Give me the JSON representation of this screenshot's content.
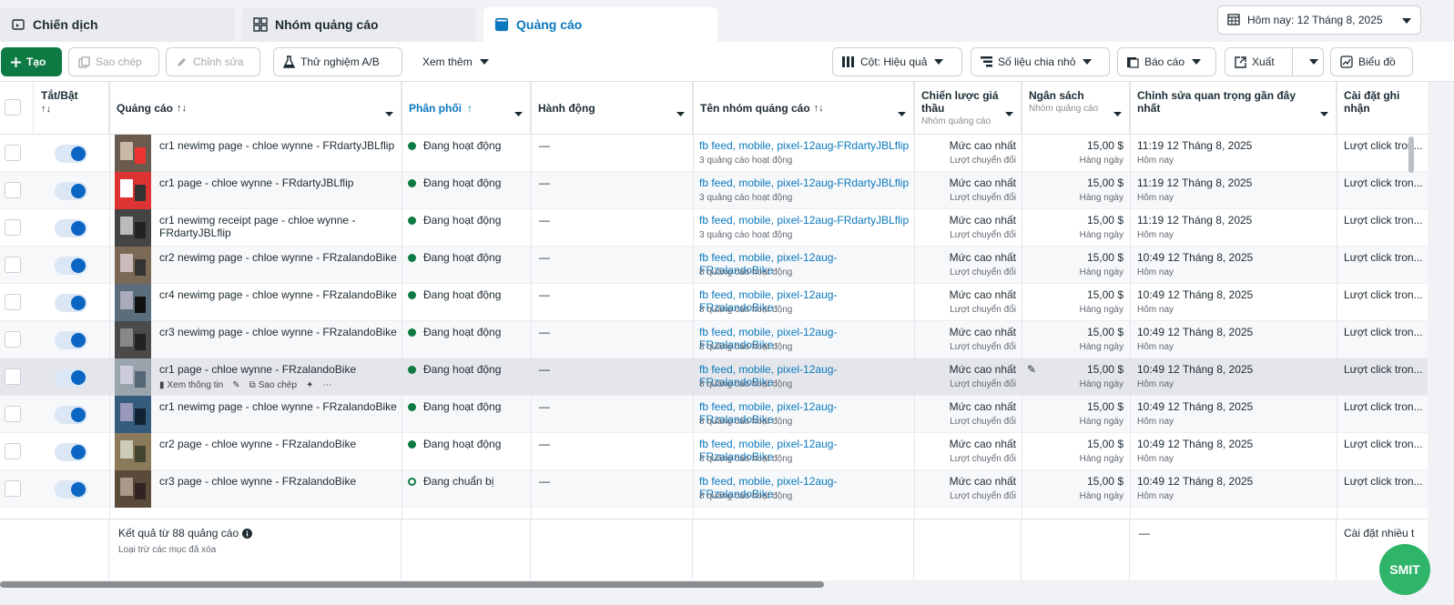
{
  "tabs": [
    {
      "label": "Chiến dịch",
      "icon": "folder-icon",
      "active": false
    },
    {
      "label": "Nhóm quảng cáo",
      "icon": "grid-icon",
      "active": false
    },
    {
      "label": "Quảng cáo",
      "icon": "ad-icon",
      "active": true
    }
  ],
  "date_range": {
    "label": "Hôm nay: 12 Tháng 8, 2025"
  },
  "toolbar": {
    "create": "Tạo",
    "duplicate": "Sao chép",
    "edit": "Chỉnh sửa",
    "ab_test": "Thử nghiệm A/B",
    "more": "Xem thêm",
    "columns": "Cột: Hiệu quả",
    "breakdown": "Số liệu chia nhỏ",
    "reports": "Báo cáo",
    "export": "Xuất",
    "charts": "Biểu đồ"
  },
  "columns": {
    "toggle": "Tắt/Bật",
    "ad": "Quảng cáo",
    "delivery": "Phân phối",
    "actions": "Hành động",
    "adset": "Tên nhóm quảng cáo",
    "bid_strategy": "Chiến lược giá thầu",
    "bid_strategy_sub": "Nhóm quảng cáo",
    "budget": "Ngân sách",
    "budget_sub": "Nhóm quảng cáo",
    "last_edit": "Chỉnh sửa quan trọng gần đây nhất",
    "attribution": "Cài đặt ghi nhận"
  },
  "rows": [
    {
      "name": "cr1 newimg page - chloe wynne - FRdartyJBLflip",
      "status": "Đang hoạt động",
      "action": "—",
      "adset": "fb feed, mobile, pixel-12aug-FRdartyJBLflip",
      "adset_sub": "3 quảng cáo hoạt động",
      "bid": "Mức cao nhất",
      "bid_sub": "Lượt chuyển đổi",
      "budget": "15,00 $",
      "budget_sub": "Hàng ngày",
      "edited": "11:19 12 Tháng 8, 2025",
      "edited_sub": "Hôm nay",
      "attribution": "Lượt click tron..."
    },
    {
      "name": "cr1 page - chloe wynne - FRdartyJBLflip",
      "status": "Đang hoạt động",
      "action": "—",
      "adset": "fb feed, mobile, pixel-12aug-FRdartyJBLflip",
      "adset_sub": "3 quảng cáo hoạt động",
      "bid": "Mức cao nhất",
      "bid_sub": "Lượt chuyển đổi",
      "budget": "15,00 $",
      "budget_sub": "Hàng ngày",
      "edited": "11:19 12 Tháng 8, 2025",
      "edited_sub": "Hôm nay",
      "attribution": "Lượt click tron..."
    },
    {
      "name": "cr1 newimg receipt page - chloe wynne - FRdartyJBLflip",
      "status": "Đang hoạt động",
      "action": "—",
      "adset": "fb feed, mobile, pixel-12aug-FRdartyJBLflip",
      "adset_sub": "3 quảng cáo hoạt động",
      "bid": "Mức cao nhất",
      "bid_sub": "Lượt chuyển đổi",
      "budget": "15,00 $",
      "budget_sub": "Hàng ngày",
      "edited": "11:19 12 Tháng 8, 2025",
      "edited_sub": "Hôm nay",
      "attribution": "Lượt click tron..."
    },
    {
      "name": "cr2 newimg page - chloe wynne - FRzalandoBike",
      "status": "Đang hoạt động",
      "action": "—",
      "adset": "fb feed, mobile, pixel-12aug-FRzalandoBike",
      "adset_sub": "8 quảng cáo hoạt động",
      "bid": "Mức cao nhất",
      "bid_sub": "Lượt chuyển đổi",
      "budget": "15,00 $",
      "budget_sub": "Hàng ngày",
      "edited": "10:49 12 Tháng 8, 2025",
      "edited_sub": "Hôm nay",
      "attribution": "Lượt click tron..."
    },
    {
      "name": "cr4 newimg page - chloe wynne - FRzalandoBike",
      "status": "Đang hoạt động",
      "action": "—",
      "adset": "fb feed, mobile, pixel-12aug-FRzalandoBike",
      "adset_sub": "8 quảng cáo hoạt động",
      "bid": "Mức cao nhất",
      "bid_sub": "Lượt chuyển đổi",
      "budget": "15,00 $",
      "budget_sub": "Hàng ngày",
      "edited": "10:49 12 Tháng 8, 2025",
      "edited_sub": "Hôm nay",
      "attribution": "Lượt click tron..."
    },
    {
      "name": "cr3 newimg page - chloe wynne - FRzalandoBike",
      "status": "Đang hoạt động",
      "action": "—",
      "adset": "fb feed, mobile, pixel-12aug-FRzalandoBike",
      "adset_sub": "8 quảng cáo hoạt động",
      "bid": "Mức cao nhất",
      "bid_sub": "Lượt chuyển đổi",
      "budget": "15,00 $",
      "budget_sub": "Hàng ngày",
      "edited": "10:49 12 Tháng 8, 2025",
      "edited_sub": "Hôm nay",
      "attribution": "Lượt click tron..."
    },
    {
      "name": "cr1 page - chloe wynne - FRzalandoBike",
      "status": "Đang hoạt động",
      "action": "—",
      "adset": "fb feed, mobile, pixel-12aug-FRzalandoBike",
      "adset_sub": "8 quảng cáo hoạt động",
      "bid": "Mức cao nhất",
      "bid_sub": "Lượt chuyển đổi",
      "budget": "15,00 $",
      "budget_sub": "Hàng ngày",
      "edited": "10:49 12 Tháng 8, 2025",
      "edited_sub": "Hôm nay",
      "attribution": "Lượt click tron...",
      "hover": true,
      "hover_view": "Xem thông tin",
      "hover_copy": "Sao chép"
    },
    {
      "name": "cr1 newimg page - chloe wynne - FRzalandoBike",
      "status": "Đang hoạt động",
      "action": "—",
      "adset": "fb feed, mobile, pixel-12aug-FRzalandoBike",
      "adset_sub": "8 quảng cáo hoạt động",
      "bid": "Mức cao nhất",
      "bid_sub": "Lượt chuyển đổi",
      "budget": "15,00 $",
      "budget_sub": "Hàng ngày",
      "edited": "10:49 12 Tháng 8, 2025",
      "edited_sub": "Hôm nay",
      "attribution": "Lượt click tron..."
    },
    {
      "name": "cr2 page - chloe wynne - FRzalandoBike",
      "status": "Đang hoạt động",
      "action": "—",
      "adset": "fb feed, mobile, pixel-12aug-FRzalandoBike",
      "adset_sub": "8 quảng cáo hoạt động",
      "bid": "Mức cao nhất",
      "bid_sub": "Lượt chuyển đổi",
      "budget": "15,00 $",
      "budget_sub": "Hàng ngày",
      "edited": "10:49 12 Tháng 8, 2025",
      "edited_sub": "Hôm nay",
      "attribution": "Lượt click tron..."
    },
    {
      "name": "cr3 page - chloe wynne - FRzalandoBike",
      "status": "Đang chuẩn bị",
      "status_pending": true,
      "action": "—",
      "adset": "fb feed, mobile, pixel-12aug-FRzalandoBike",
      "adset_sub": "8 quảng cáo hoạt động",
      "bid": "Mức cao nhất",
      "bid_sub": "Lượt chuyển đổi",
      "budget": "15,00 $",
      "budget_sub": "Hàng ngày",
      "edited": "10:49 12 Tháng 8, 2025",
      "edited_sub": "Hôm nay",
      "attribution": "Lượt click tron..."
    }
  ],
  "footer": {
    "results": "Kết quả từ 88 quảng cáo",
    "excluded": "Loại trừ các mục đã xóa",
    "edited": "—",
    "attribution": "Cài đặt nhiều t"
  },
  "fab": {
    "label": "SMIT"
  },
  "colors": {
    "accent": "#0a78be",
    "create": "#0e7a43",
    "active_dot": "#0e7a43",
    "fab": "#2fb56a"
  }
}
